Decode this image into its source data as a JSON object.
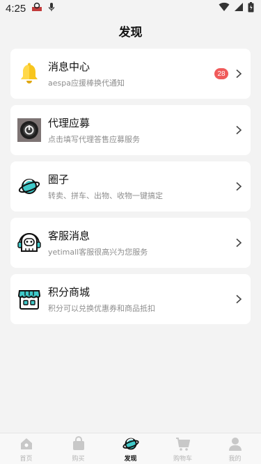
{
  "status": {
    "time": "4:25"
  },
  "header": {
    "title": "发现"
  },
  "items": [
    {
      "title": "消息中心",
      "subtitle": "aespa应援棒换代通知",
      "badge": "28",
      "icon": "bell-icon"
    },
    {
      "title": "代理应募",
      "subtitle": "点击填写代理答售应募服务",
      "badge": "",
      "icon": "camera-icon"
    },
    {
      "title": "圈子",
      "subtitle": "转卖、拼车、出物、收物一键搞定",
      "badge": "",
      "icon": "planet-icon"
    },
    {
      "title": "客服消息",
      "subtitle": "yetimall客服很高兴为您服务",
      "badge": "",
      "icon": "support-icon"
    },
    {
      "title": "积分商城",
      "subtitle": "积分可以兑换优惠券和商品抵扣",
      "badge": "",
      "icon": "store-icon"
    }
  ],
  "tabs": [
    {
      "label": "首页",
      "icon": "home-icon"
    },
    {
      "label": "购买",
      "icon": "bag-icon"
    },
    {
      "label": "发现",
      "icon": "planet-icon"
    },
    {
      "label": "购物车",
      "icon": "cart-icon"
    },
    {
      "label": "我的",
      "icon": "person-icon"
    }
  ],
  "colors": {
    "accent": "#3fc9c9",
    "badge": "#f05a5a",
    "bell": "#f7c51e"
  }
}
